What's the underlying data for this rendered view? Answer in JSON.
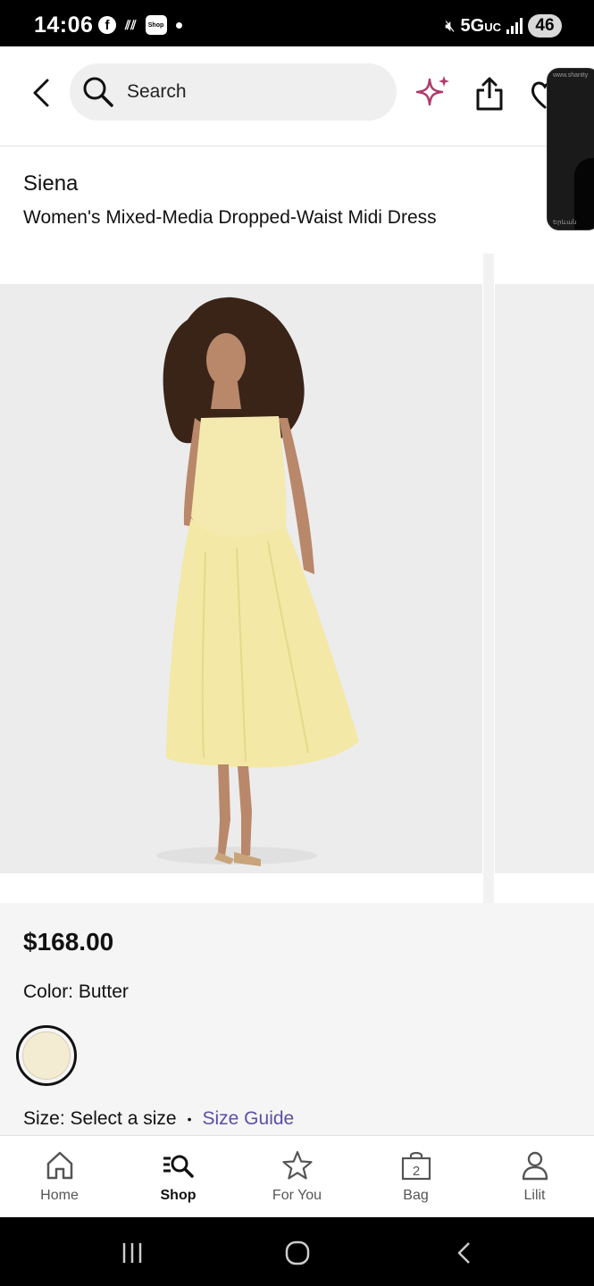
{
  "status_bar": {
    "time": "14:06",
    "shop_badge": "Shop",
    "network": "5G",
    "network_suffix": "UC",
    "battery": "46"
  },
  "header": {
    "search_placeholder": "Search"
  },
  "video_thumb": {
    "caption_top": "www.shantty",
    "caption_bottom": "Երևան"
  },
  "product": {
    "brand": "Siena",
    "name": "Women's Mixed-Media Dropped-Waist Midi Dress",
    "price": "$168.00",
    "color_label": "Color: Butter",
    "swatch_color": "#f3ecd2",
    "size_label": "Size: Select a size",
    "size_separator": "•",
    "size_guide": "Size Guide"
  },
  "tabs": [
    {
      "label": "Home",
      "icon": "home-icon"
    },
    {
      "label": "Shop",
      "icon": "shop-search-icon"
    },
    {
      "label": "For You",
      "icon": "star-icon"
    },
    {
      "label": "Bag",
      "icon": "bag-icon",
      "badge": "2"
    },
    {
      "label": "Lilit",
      "icon": "person-icon"
    }
  ],
  "colors": {
    "accent_purple": "#5b4fa6",
    "sparkle": "#b03a6b"
  }
}
